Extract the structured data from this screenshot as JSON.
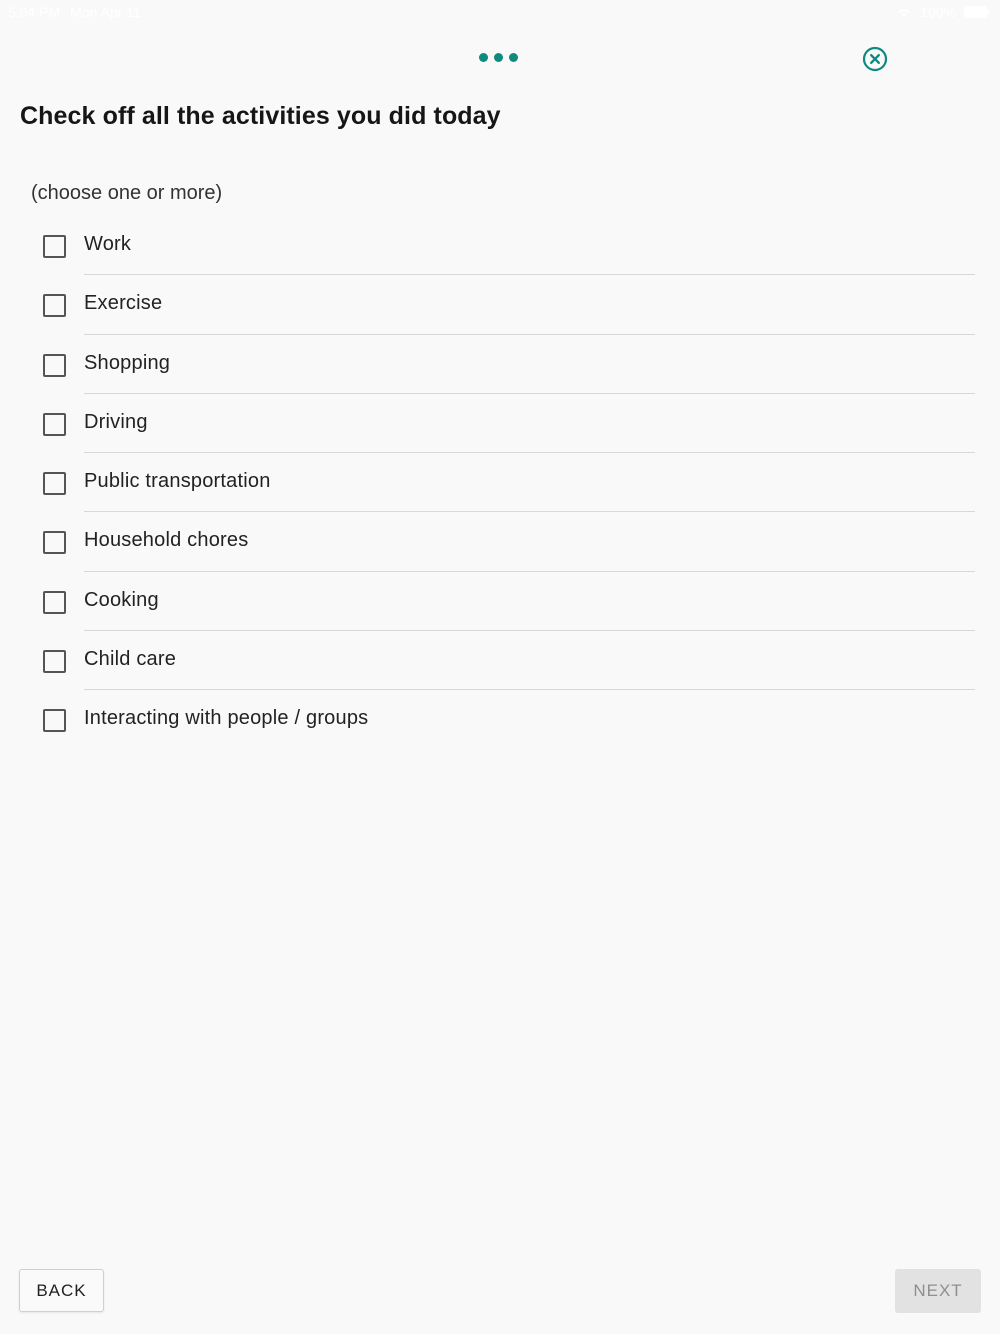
{
  "status_bar": {
    "time": "5:04 PM",
    "date": "Mon Apr 11",
    "battery": "100%"
  },
  "header": {
    "progress_dots": 3,
    "accent_color": "#0f8a7e",
    "close_icon": "close-circle-icon"
  },
  "question": {
    "title": "Check off all the activities you did today",
    "instruction": "(choose one or more)"
  },
  "options": [
    {
      "label": "Work",
      "checked": false
    },
    {
      "label": "Exercise",
      "checked": false
    },
    {
      "label": "Shopping",
      "checked": false
    },
    {
      "label": "Driving",
      "checked": false
    },
    {
      "label": "Public transportation",
      "checked": false
    },
    {
      "label": "Household chores",
      "checked": false
    },
    {
      "label": "Cooking",
      "checked": false
    },
    {
      "label": "Child care",
      "checked": false
    },
    {
      "label": "Interacting with people / groups",
      "checked": false
    }
  ],
  "footer": {
    "back_label": "BACK",
    "next_label": "NEXT",
    "next_enabled": false
  }
}
